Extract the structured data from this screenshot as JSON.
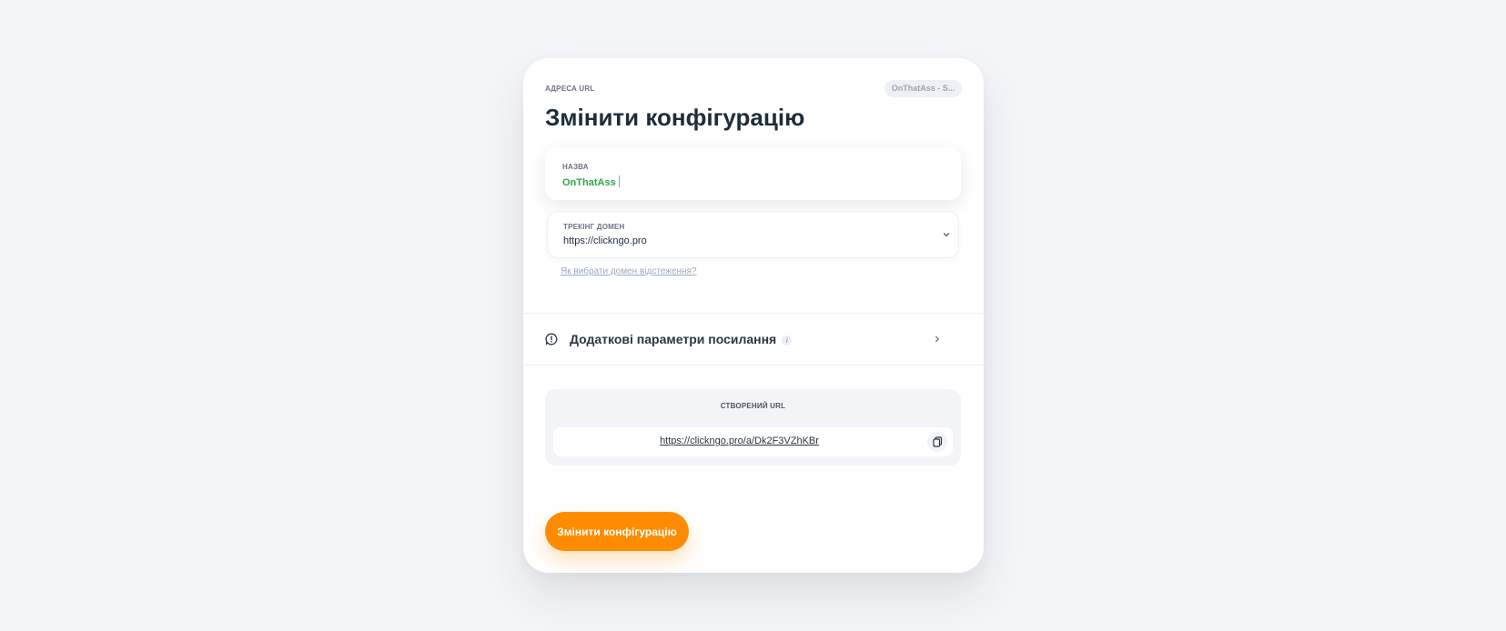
{
  "card": {
    "eyebrow": "АДРЕСА URL",
    "chip": "OnThatAss - S...",
    "title": "Змінити конфігурацію"
  },
  "name_field": {
    "label": "НАЗВА",
    "value": "OnThatAss"
  },
  "domain_field": {
    "label": "ТРЕКІНГ ДОМЕН",
    "value": "https://clickngo.pro",
    "help_link": "Як вибрати домен відстеження?"
  },
  "params": {
    "label": "Додаткові параметри посилання",
    "info": "i"
  },
  "generated_url": {
    "label": "СТВОРЕНИЙ URL",
    "url": "https://clickngo.pro/a/Dk2F3VZhKBr"
  },
  "submit_label": "Змінити конфігурацію",
  "colors": {
    "accent": "#ff8c00",
    "name_value": "#2ea84a",
    "title": "#1f2d3a",
    "background": "#f4f5f8"
  },
  "icons": [
    "chevron-down-icon",
    "alert-circle-icon",
    "info-icon",
    "chevron-right-icon",
    "copy-icon"
  ]
}
